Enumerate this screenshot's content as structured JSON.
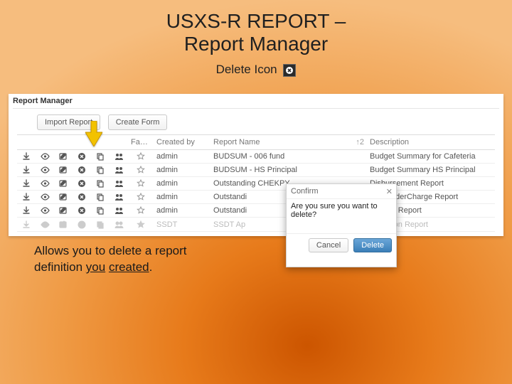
{
  "slide": {
    "title_l1": "USXS-R REPORT –",
    "title_l2": "Report Manager",
    "delete_label": "Delete Icon",
    "caption_pre": "Allows you to delete a report",
    "caption_mid1": "definition ",
    "caption_u": "you",
    "caption_mid2": " ",
    "caption_u2": "created",
    "caption_end": "."
  },
  "panel": {
    "title": "Report Manager",
    "buttons": {
      "import": "Import Report",
      "create": "Create Form"
    },
    "columns": {
      "favorite": "Favorite",
      "created_by": "Created by",
      "report_name": "Report Name",
      "description": "Description"
    },
    "rows": [
      {
        "created_by": "admin",
        "report_name": "BUDSUM - 006 fund",
        "description": "Budget Summary for Cafeteria",
        "fav": false
      },
      {
        "created_by": "admin",
        "report_name": "BUDSUM - HS Principal",
        "description": "Budget Summary HS Principal",
        "fav": false
      },
      {
        "created_by": "admin",
        "report_name": "Outstanding CHEKPY",
        "description": "Disbursement Report",
        "fav": false
      },
      {
        "created_by": "admin",
        "report_name": "Outstandi",
        "description": "haseOrderCharge Report",
        "fav": false
      },
      {
        "created_by": "admin",
        "report_name": "Outstandi",
        "description": "luisition Report",
        "fav": false
      },
      {
        "created_by": "SSDT",
        "report_name": "SSDT Ap",
        "description": "ropriation Report",
        "fav": false,
        "greyed": true
      }
    ]
  },
  "dialog": {
    "title": "Confirm",
    "message": "Are you sure you want to delete?",
    "cancel": "Cancel",
    "confirm": "Delete"
  }
}
